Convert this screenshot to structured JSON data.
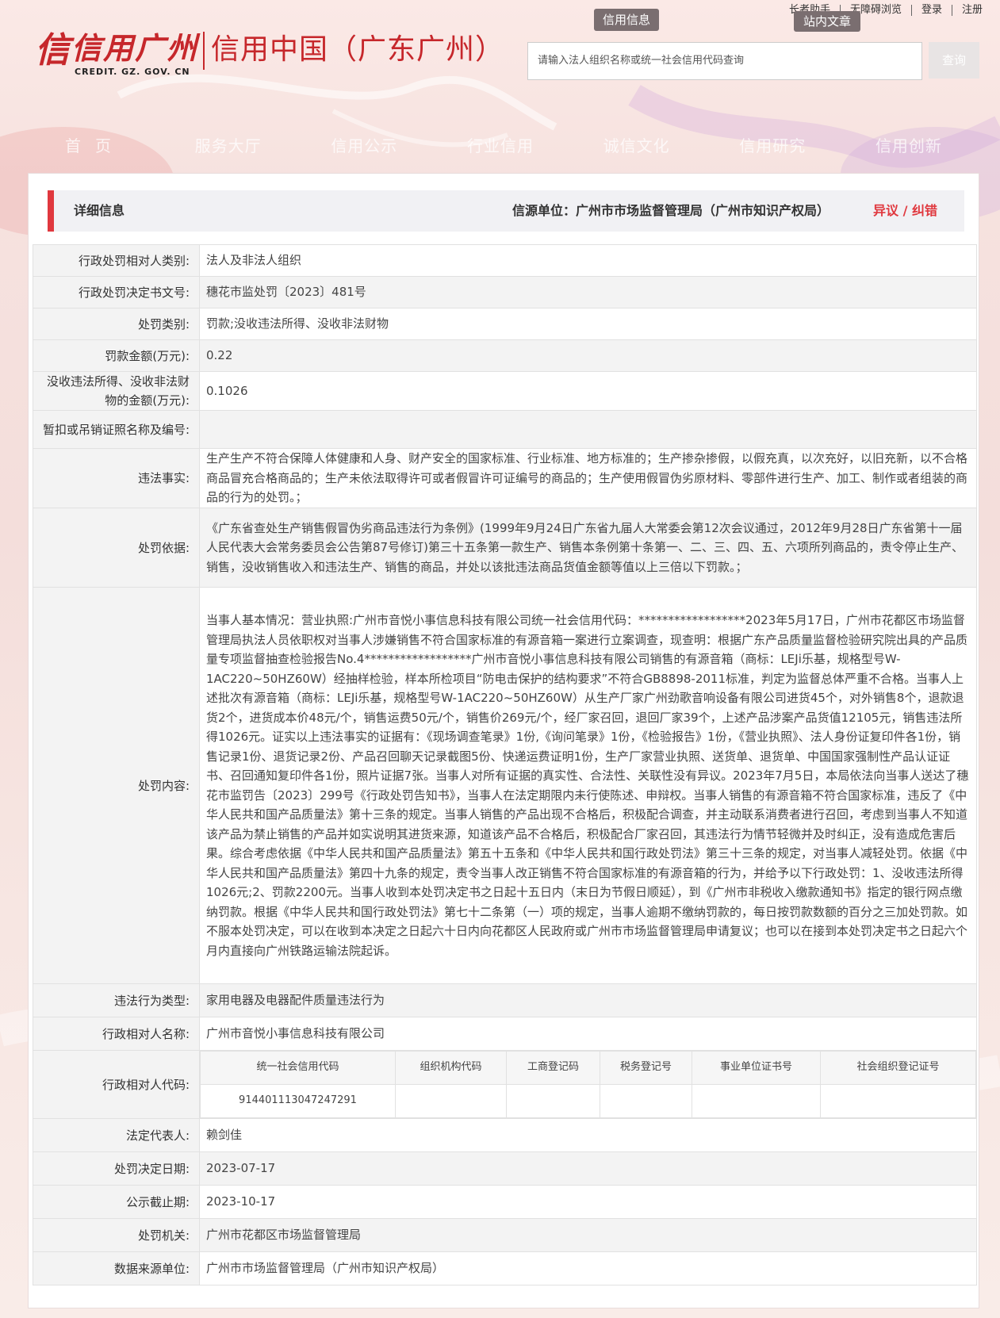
{
  "toplinks": [
    "长者助手",
    "无障碍浏览",
    "登录",
    "注册"
  ],
  "tags": {
    "xyxx": "信用信息",
    "znwz": "站内文章"
  },
  "logo": {
    "mark": "信",
    "main": "信用广州",
    "sub": "CREDIT. GZ. GOV. CN",
    "right": "信用中国（广东广州）"
  },
  "search": {
    "placeholder": "请输入法人组织名称或统一社会信用代码查询",
    "button": "查询"
  },
  "nav": [
    "首页",
    "服务大厅",
    "信用公示",
    "行业信用",
    "诚信文化",
    "信用研究",
    "信用创新"
  ],
  "header": {
    "title": "详细信息",
    "source": "信源单位：广州市市场监督管理局（广州市知识产权局）",
    "link": "异议 / 纠错"
  },
  "rows": {
    "r1": {
      "label": "行政处罚相对人类别:",
      "value": "法人及非法人组织"
    },
    "r2": {
      "label": "行政处罚决定书文号:",
      "value": "穗花市监处罚〔2023〕481号"
    },
    "r3": {
      "label": "处罚类别:",
      "value": "罚款;没收违法所得、没收非法财物"
    },
    "r4": {
      "label": "罚款金额(万元):",
      "value": "0.22"
    },
    "r5": {
      "label": "没收违法所得、没收非法财物的金额(万元):",
      "value": "0.1026"
    },
    "r6": {
      "label": "暂扣或吊销证照名称及编号:",
      "value": ""
    },
    "r7": {
      "label": "违法事实:",
      "value": "生产生产不符合保障人体健康和人身、财产安全的国家标准、行业标准、地方标准的；生产掺杂掺假，以假充真，以次充好，以旧充新，以不合格商品冒充合格商品的；生产未依法取得许可或者假冒许可证编号的商品的；生产使用假冒伪劣原材料、零部件进行生产、加工、制作或者组装的商品的行为的处罚。；"
    },
    "r8": {
      "label": "处罚依据:",
      "value": "《广东省查处生产销售假冒伪劣商品违法行为条例》(1999年9月24日广东省九届人大常委会第12次会议通过，2012年9月28日广东省第十一届人民代表大会常务委员会公告第87号修订)第三十五条第一款生产、销售本条例第十条第一、二、三、四、五、六项所列商品的，责令停止生产、销售，没收销售收入和违法生产、销售的商品，并处以该批违法商品货值金额等值以上三倍以下罚款。；"
    },
    "r9": {
      "label": "处罚内容:",
      "value": "当事人基本情况：营业执照:广州市音悦小事信息科技有限公司统一社会信用代码：******************2023年5月17日，广州市花都区市场监督管理局执法人员依职权对当事人涉嫌销售不符合国家标准的有源音箱一案进行立案调查，现查明：根据广东产品质量监督检验研究院出具的产品质量专项监督抽查检验报告No.4******************广州市音悦小事信息科技有限公司销售的有源音箱（商标：LEJi乐基，规格型号W-1AC220~50HZ60W）经抽样检验，样本所检项目“防电击保护的结构要求”不符合GB8898-2011标准，判定为监督总体严重不合格。当事人上述批次有源音箱（商标：LEJi乐基，规格型号W-1AC220~50HZ60W）从生产厂家广州劲歌音响设备有限公司进货45个，对外销售8个，退款退货2个，进货成本价48元/个，销售运费50元/个，销售价269元/个，经厂家召回，退回厂家39个，上述产品涉案产品货值12105元，销售违法所得1026元。证实以上违法事实的证据有：《现场调查笔录》1份,《询问笔录》1份，《检验报告》1份，《营业执照》、法人身份证复印件各1份，销售记录1份、退货记录2份、产品召回聊天记录截图5份、快递运费证明1份，生产厂家营业执照、送货单、退货单、中国国家强制性产品认证证书、召回通知复印件各1份，照片证据7张。当事人对所有证据的真实性、合法性、关联性没有异议。2023年7月5日，本局依法向当事人送达了穗花市监罚告〔2023〕299号《行政处罚告知书》，当事人在法定期限内未行使陈述、申辩权。当事人销售的有源音箱不符合国家标准，违反了《中华人民共和国产品质量法》第十三条的规定。当事人销售的产品出现不合格后，积极配合调查，并主动联系消费者进行召回，考虑到当事人不知道该产品为禁止销售的产品并如实说明其进货来源，知道该产品不合格后，积极配合厂家召回，其违法行为情节轻微并及时纠正，没有造成危害后果。综合考虑依据《中华人民共和国产品质量法》第五十五条和《中华人民共和国行政处罚法》第三十三条的规定，对当事人减轻处罚。依据《中华人民共和国产品质量法》第四十九条的规定，责令当事人改正销售不符合国家标准的有源音箱的行为，并给予以下行政处罚：1、没收违法所得1026元;2、罚款2200元。当事人收到本处罚决定书之日起十五日内（末日为节假日顺延），到《广州市非税收入缴款通知书》指定的银行网点缴纳罚款。根据《中华人民共和国行政处罚法》第七十二条第（一）项的规定，当事人逾期不缴纳罚款的，每日按罚款数额的百分之三加处罚款。如不服本处罚决定，可以在收到本决定之日起六十日内向花都区人民政府或广州市市场监督管理局申请复议；也可以在接到本处罚决定书之日起六个月内直接向广州铁路运输法院起诉。"
    },
    "r10": {
      "label": "违法行为类型:",
      "value": "家用电器及电器配件质量违法行为"
    },
    "r11": {
      "label": "行政相对人名称:",
      "value": "广州市音悦小事信息科技有限公司"
    },
    "r12": {
      "label": "行政相对人代码:"
    },
    "r13": {
      "label": "法定代表人:",
      "value": "赖剑佳"
    },
    "r14": {
      "label": "处罚决定日期:",
      "value": "2023-07-17"
    },
    "r15": {
      "label": "公示截止期:",
      "value": "2023-10-17"
    },
    "r16": {
      "label": "处罚机关:",
      "value": "广州市花都区市场监督管理局"
    },
    "r17": {
      "label": "数据来源单位:",
      "value": "广州市市场监督管理局（广州市知识产权局）"
    }
  },
  "codes": {
    "headers": [
      "统一社会信用代码",
      "组织机构代码",
      "工商登记码",
      "税务登记号",
      "事业单位证书号",
      "社会组织登记证号"
    ],
    "values": [
      "914401113047247291",
      "",
      "",
      "",
      "",
      ""
    ]
  }
}
